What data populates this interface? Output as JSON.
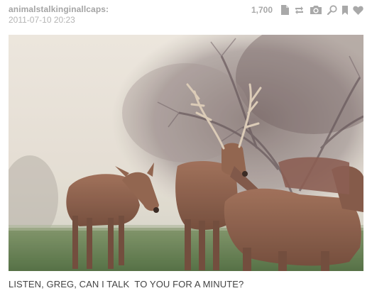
{
  "post": {
    "author": "animalstalkinginallcaps:",
    "timestamp": "2011-07-10 20:23",
    "notes_count": "1,700",
    "caption": "LISTEN, GREG, CAN I TALK  TO YOU FOR A MINUTE?"
  },
  "toolbar": {
    "icons": [
      "document-icon",
      "reblog-icon",
      "camera-icon",
      "search-icon",
      "bookmark-icon",
      "heart-icon"
    ],
    "icon_color": "#a9a9a9"
  },
  "photo": {
    "subject": "deer-herd-photo",
    "palette": {
      "sky": "#e9e4da",
      "grass": "#5d7c4a",
      "deer": "#8a5a42"
    }
  }
}
